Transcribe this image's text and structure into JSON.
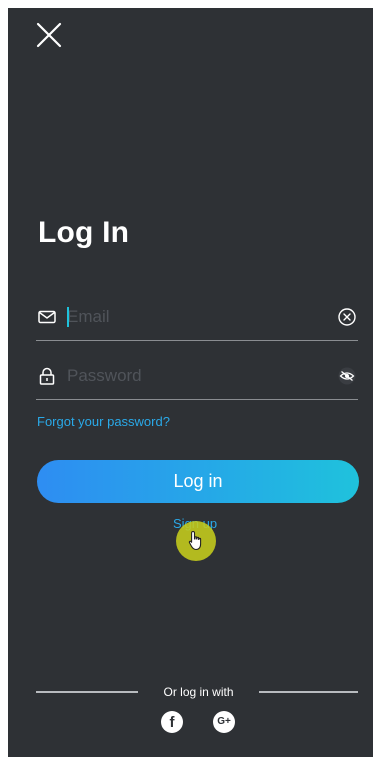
{
  "header": {
    "close_icon": "close-icon"
  },
  "title": "Log In",
  "email": {
    "placeholder": "Email",
    "value": "",
    "lead_icon": "envelope-icon",
    "trail_icon": "clear-circle-icon"
  },
  "password": {
    "placeholder": "Password",
    "value": "",
    "lead_icon": "lock-icon",
    "trail_icon": "eye-hidden-icon"
  },
  "forgot_label": "Forgot your password?",
  "login_label": "Log in",
  "signup_label": "Sign up",
  "social": {
    "divider_label": "Or log in with",
    "facebook_glyph": "f",
    "google_glyph": "G+"
  },
  "colors": {
    "background": "#2e3135",
    "accent": "#2aa9e8",
    "button_gradient_start": "#2e8df2",
    "button_gradient_end": "#1fc2dc",
    "cursor_highlight": "#c6cd1c"
  }
}
